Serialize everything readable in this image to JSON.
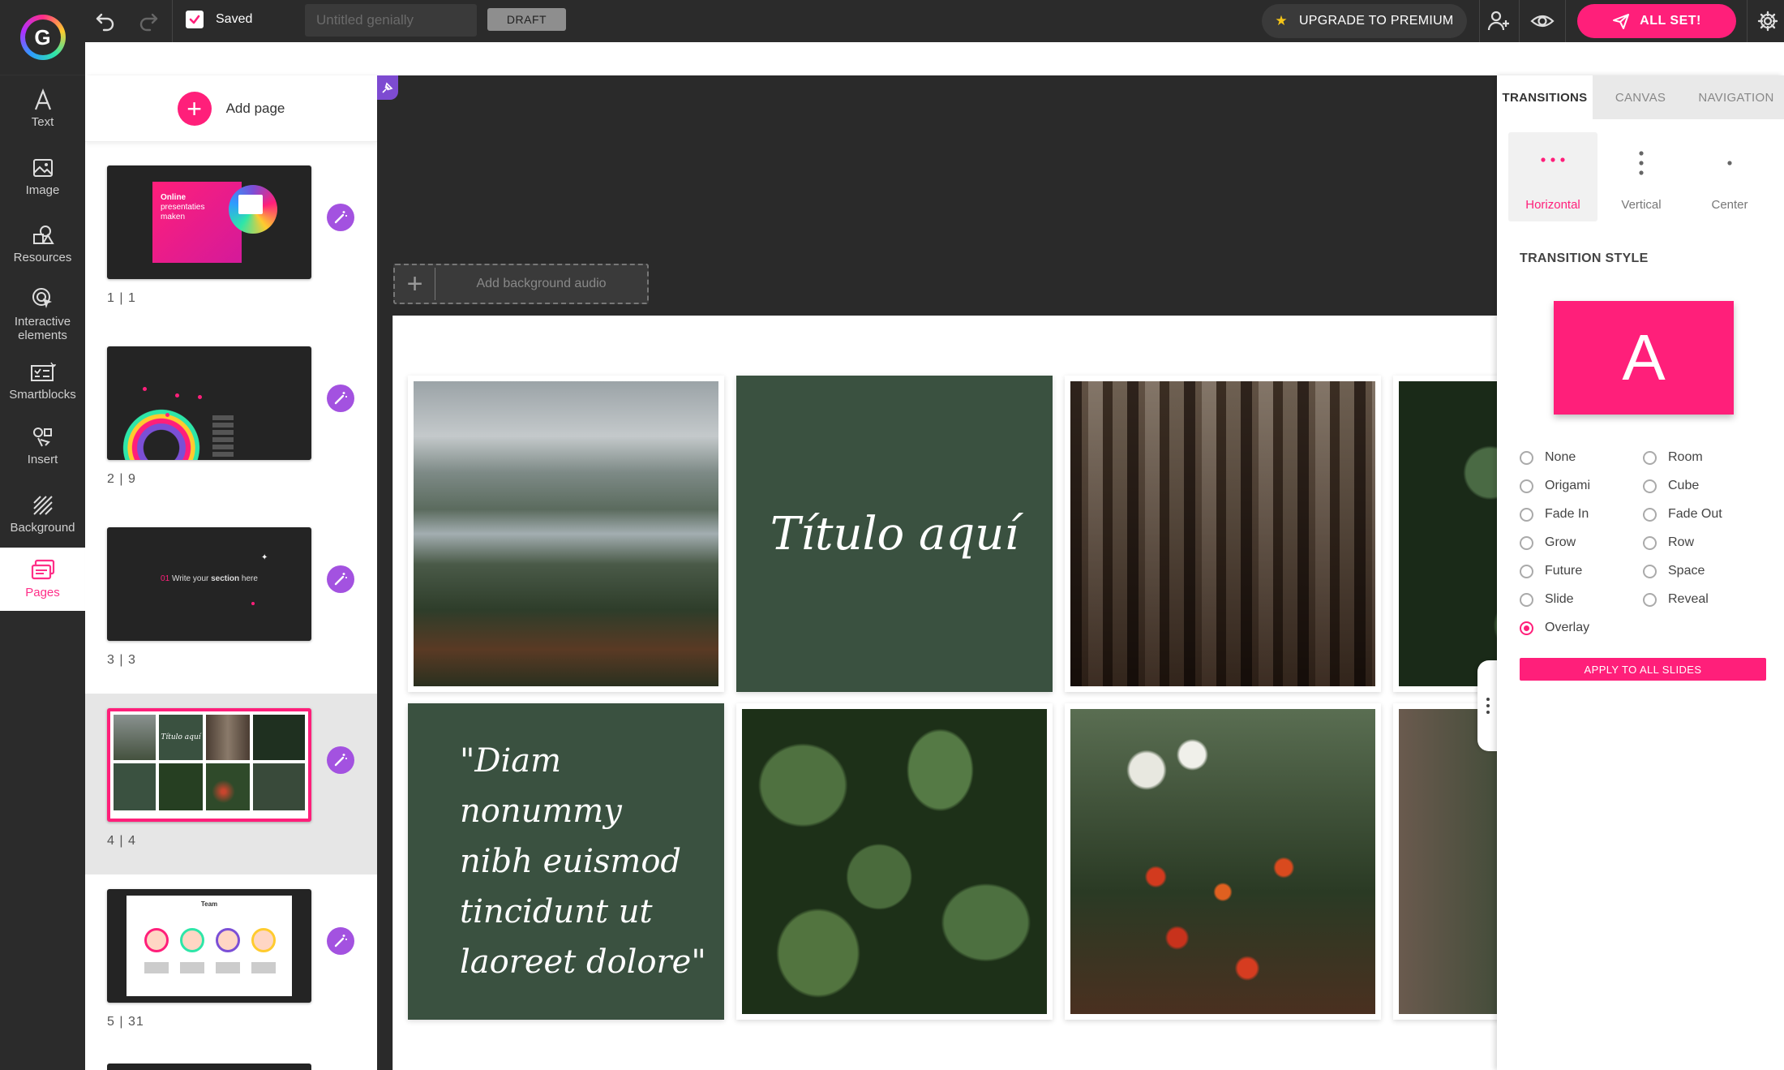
{
  "topbar": {
    "logo_letter": "G",
    "saved_label": "Saved",
    "title_placeholder": "Untitled genially",
    "draft_label": "DRAFT",
    "premium_label": "UPGRADE TO PREMIUM",
    "allset_label": "ALL SET!",
    "accent_color": "#ff1f7a"
  },
  "sidebar": {
    "items": [
      {
        "label": "Text",
        "icon": "text-icon"
      },
      {
        "label": "Image",
        "icon": "image-icon"
      },
      {
        "label": "Resources",
        "icon": "resources-icon"
      },
      {
        "label": "Interactive elements",
        "icon": "interactive-icon"
      },
      {
        "label": "Smartblocks",
        "icon": "smartblocks-icon"
      },
      {
        "label": "Insert",
        "icon": "insert-icon"
      },
      {
        "label": "Background",
        "icon": "background-icon"
      },
      {
        "label": "Pages",
        "icon": "pages-icon",
        "active": true
      }
    ]
  },
  "pages_panel": {
    "add_page_label": "Add page",
    "pages": [
      {
        "number": "1 | 1",
        "title_lines": [
          "Online",
          "presentaties",
          "maken"
        ]
      },
      {
        "number": "2 | 9"
      },
      {
        "number": "3 | 3",
        "section_prefix": "01",
        "section_text": "Write your",
        "section_bold": "section",
        "section_suffix": "here"
      },
      {
        "number": "4 | 4",
        "selected": true,
        "mini_title": "Título aquí"
      },
      {
        "number": "5 | 31",
        "mini_title": "Team"
      }
    ]
  },
  "canvas": {
    "bg_audio_label": "Add background audio",
    "slide": {
      "title_text": "Título aquí",
      "quote_lines": [
        "\"Diam nonummy",
        "nibh euismod",
        "tincidunt ut",
        "laoreet dolore\""
      ]
    }
  },
  "right_panel": {
    "tabs": [
      "TRANSITIONS",
      "CANVAS",
      "NAVIGATION"
    ],
    "active_tab": "TRANSITIONS",
    "directions": [
      "Horizontal",
      "Vertical",
      "Center"
    ],
    "active_direction": "Horizontal",
    "style_heading": "TRANSITION STYLE",
    "preview_letter": "A",
    "styles_left": [
      "None",
      "Origami",
      "Fade In",
      "Grow",
      "Future",
      "Slide",
      "Overlay"
    ],
    "styles_right": [
      "Room",
      "Cube",
      "Fade Out",
      "Row",
      "Space",
      "Reveal"
    ],
    "selected_style": "Overlay",
    "apply_label": "APPLY TO ALL SLIDES"
  }
}
